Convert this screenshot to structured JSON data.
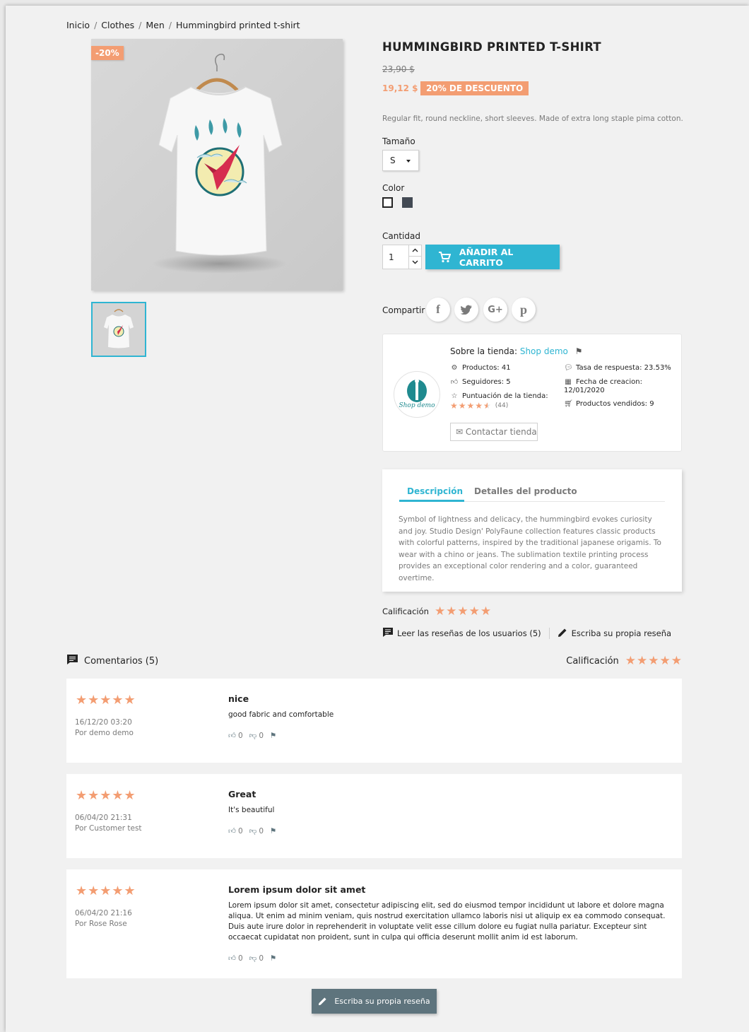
{
  "breadcrumb": [
    "Inicio",
    "Clothes",
    "Men",
    "Hummingbird printed t-shirt"
  ],
  "product": {
    "discount_flag": "-20%",
    "title": "HUMMINGBIRD PRINTED T-SHIRT",
    "old_price": "23,90 $",
    "new_price": "19,12 $",
    "discount_badge": "20% DE DESCUENTO",
    "short_description": "Regular fit, round neckline, short sleeves. Made of extra long staple pima cotton.",
    "size_label": "Tamaño",
    "size_value": "S",
    "color_label": "Color",
    "colors": [
      "#ffffff",
      "#434a54"
    ],
    "quantity_label": "Cantidad",
    "quantity": "1",
    "add_to_cart": "AÑADIR AL CARRITO",
    "share_label": "Compartir",
    "share_icons": [
      "facebook-icon",
      "twitter-icon",
      "googleplus-icon",
      "pinterest-icon"
    ]
  },
  "store": {
    "about_label": "Sobre la tienda:",
    "store_name": "Shop demo",
    "logo_text": "Shop demo",
    "products": "Productos: 41",
    "followers": "Seguidores: 5",
    "score_label": "Puntuación de la tienda:",
    "score_count": "(44)",
    "score_value": 4.5,
    "response_rate": "Tasa de respuesta: 23.53%",
    "created_label": "Fecha de creacion:",
    "created_date": "12/01/2020",
    "sold": "Productos vendidos: 9",
    "contact": "Contactar tienda"
  },
  "tabs": {
    "description_tab": "Descripción",
    "details_tab": "Detalles del producto",
    "description_text": "Symbol of lightness and delicacy, the hummingbird evokes curiosity and joy. Studio Design' PolyFaune collection features classic products with colorful patterns, inspired by the traditional japanese origamis. To wear with a chino or jeans. The sublimation textile printing process provides an exceptional color rendering and a color, guaranteed overtime."
  },
  "rating": {
    "label": "Calificación",
    "stars": 5,
    "read_reviews": "Leer las reseñas de los usuarios (5)",
    "write_review": "Escriba su propia reseña"
  },
  "comments": {
    "heading": "Comentarios (5)",
    "rating_label": "Calificación",
    "rating_stars": 5,
    "reviews": [
      {
        "stars": 5,
        "date": "16/12/20 03:20",
        "author": "Por demo demo",
        "title": "nice",
        "body": "good fabric and comfortable",
        "likes": "0",
        "dislikes": "0"
      },
      {
        "stars": 5,
        "date": "06/04/20 21:31",
        "author": "Por Customer test",
        "title": "Great",
        "body": "It's beautiful",
        "likes": "0",
        "dislikes": "0"
      },
      {
        "stars": 5,
        "date": "06/04/20 21:16",
        "author": "Por Rose Rose",
        "title": "Lorem ipsum dolor sit amet",
        "body": "Lorem ipsum dolor sit amet, consectetur adipiscing elit, sed do eiusmod tempor incididunt ut labore et dolore magna aliqua. Ut enim ad minim veniam, quis nostrud exercitation ullamco laboris nisi ut aliquip ex ea commodo consequat. Duis aute irure dolor in reprehenderit in voluptate velit esse cillum dolore eu fugiat nulla pariatur. Excepteur sint occaecat cupidatat non proident, sunt in culpa qui officia deserunt mollit anim id est laborum.",
        "likes": "0",
        "dislikes": "0"
      }
    ],
    "write_button": "Escriba su propia reseña"
  },
  "colors": {
    "accent": "#2fb5d2",
    "sale": "#f39d72",
    "dark_button": "#5e747d"
  }
}
